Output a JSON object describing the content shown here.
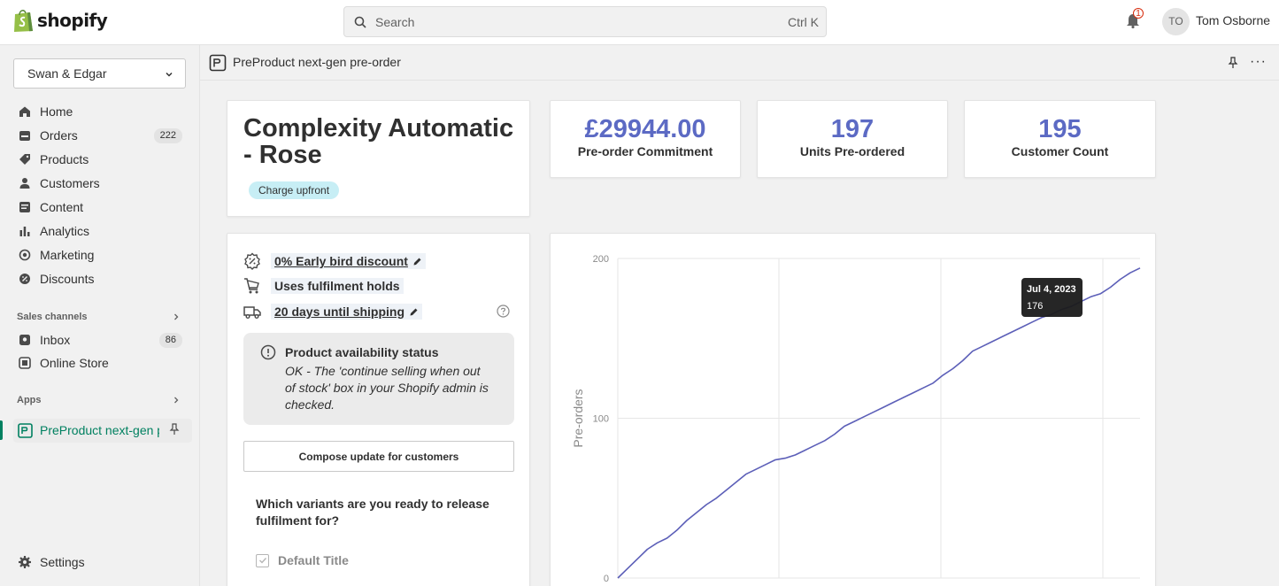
{
  "topbar": {
    "logo_text": "shopify",
    "search_placeholder": "Search",
    "search_shortcut": "Ctrl K",
    "notification_count": "1",
    "avatar_initials": "TO",
    "user_name": "Tom Osborne"
  },
  "sidebar": {
    "store_name": "Swan & Edgar",
    "items": [
      {
        "label": "Home",
        "icon": "home-icon"
      },
      {
        "label": "Orders",
        "icon": "orders-icon",
        "count": "222"
      },
      {
        "label": "Products",
        "icon": "tag-icon"
      },
      {
        "label": "Customers",
        "icon": "person-icon"
      },
      {
        "label": "Content",
        "icon": "content-icon"
      },
      {
        "label": "Analytics",
        "icon": "bar-chart-icon"
      },
      {
        "label": "Marketing",
        "icon": "target-icon"
      },
      {
        "label": "Discounts",
        "icon": "discount-icon"
      }
    ],
    "sales_channels_label": "Sales channels",
    "channels": [
      {
        "label": "Inbox",
        "icon": "inbox-icon",
        "count": "86"
      },
      {
        "label": "Online Store",
        "icon": "store-icon"
      }
    ],
    "apps_label": "Apps",
    "active_app": "PreProduct next-gen pre-order",
    "settings_label": "Settings"
  },
  "appbar": {
    "title": "PreProduct next-gen pre-order",
    "more": "···"
  },
  "product": {
    "title": "Complexity Automatic - Rose",
    "badge": "Charge upfront"
  },
  "stats": [
    {
      "value": "£29944.00",
      "label": "Pre-order Commitment"
    },
    {
      "value": "197",
      "label": "Units Pre-ordered"
    },
    {
      "value": "195",
      "label": "Customer Count"
    }
  ],
  "features": {
    "discount": "0% Early bird discount",
    "holds": "Uses fulfilment holds",
    "shipping": "20 days until shipping"
  },
  "availability": {
    "heading": "Product availability status",
    "body": "OK - The 'continue selling when out of stock' box in your Shopify admin is checked."
  },
  "compose_button": "Compose update for customers",
  "variants": {
    "question": "Which variants are you ready to release fulfilment for?",
    "items": [
      "Default Title"
    ]
  },
  "colors": {
    "accent": "#5c6ac4",
    "active_nav": "#008060",
    "line": "#5c5fb8"
  },
  "chart_data": {
    "type": "line",
    "ylabel": "Pre-orders",
    "ylim": [
      0,
      200
    ],
    "yticks": [
      "0",
      "100",
      "200"
    ],
    "grid": true,
    "tooltip": {
      "date": "Jul 4, 2023",
      "value": "176"
    },
    "series": [
      {
        "values": [
          0,
          6,
          12,
          18,
          22,
          25,
          30,
          36,
          41,
          46,
          50,
          55,
          60,
          65,
          68,
          71,
          74,
          75,
          77,
          80,
          83,
          86,
          90,
          95,
          98,
          101,
          104,
          107,
          110,
          113,
          116,
          119,
          122,
          127,
          131,
          136,
          142,
          145,
          148,
          151,
          154,
          157,
          160,
          163,
          165,
          168,
          170,
          173,
          176,
          178,
          182,
          187,
          191,
          194
        ]
      }
    ]
  }
}
